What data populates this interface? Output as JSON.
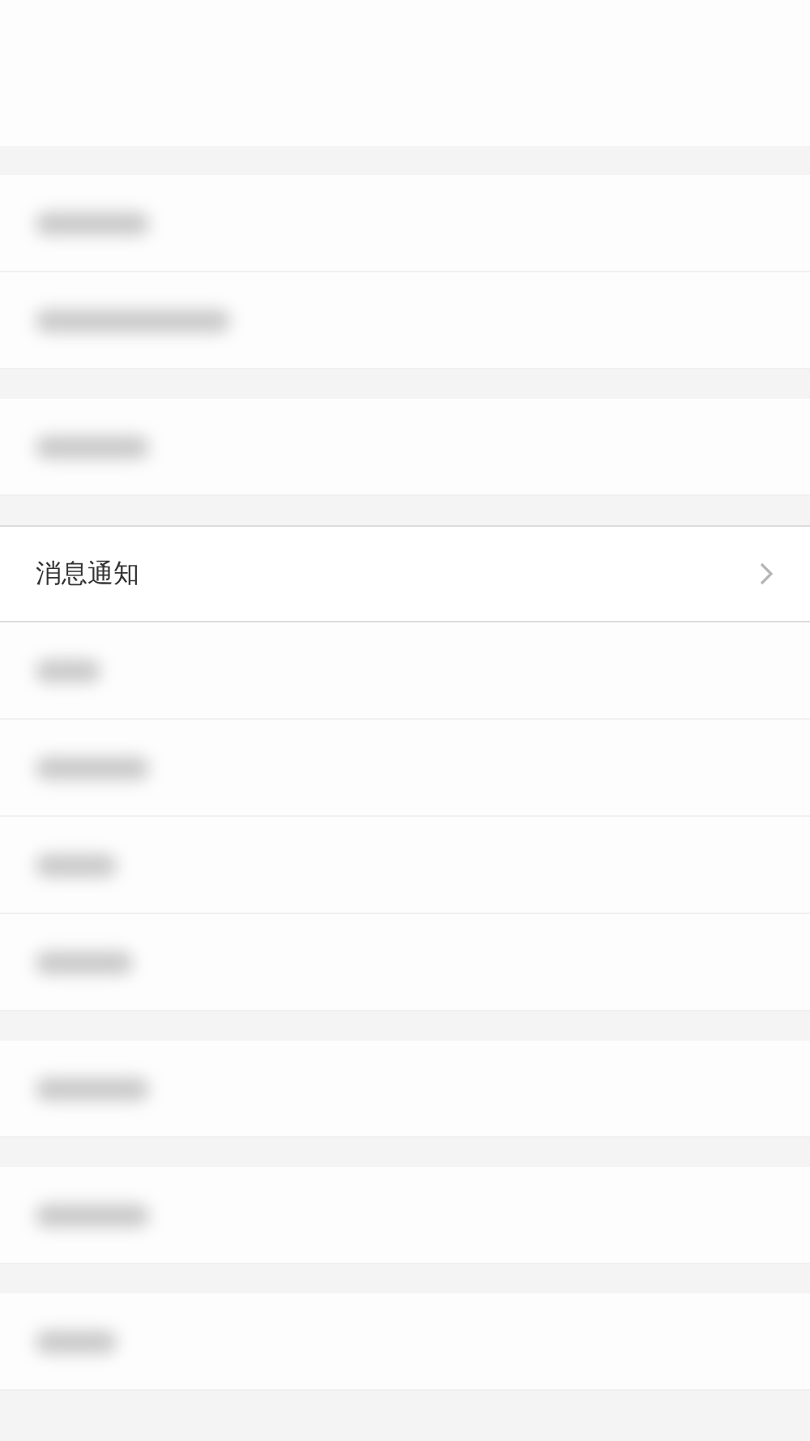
{
  "groups": [
    [
      {
        "kind": "blurred"
      },
      {
        "kind": "blurred"
      }
    ],
    [
      {
        "kind": "blurred"
      }
    ],
    [
      {
        "kind": "item",
        "label": "消息通知"
      },
      {
        "kind": "blurred"
      },
      {
        "kind": "blurred"
      },
      {
        "kind": "blurred"
      },
      {
        "kind": "blurred"
      }
    ],
    [
      {
        "kind": "blurred"
      }
    ],
    [
      {
        "kind": "blurred"
      }
    ],
    [
      {
        "kind": "blurred"
      }
    ]
  ]
}
